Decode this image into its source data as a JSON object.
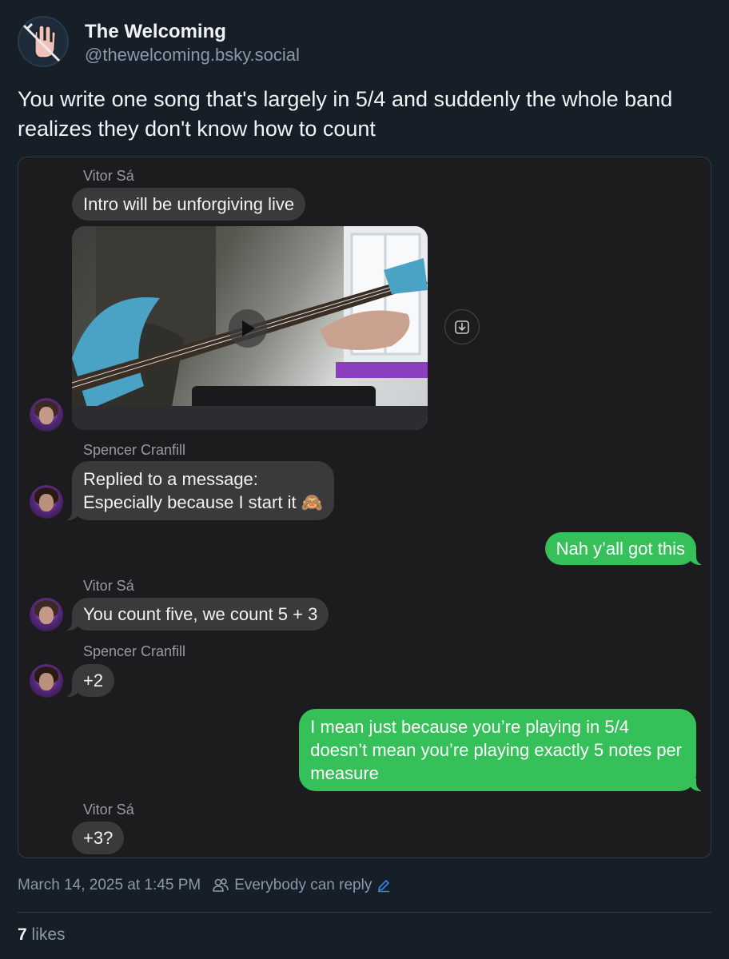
{
  "author": {
    "display_name": "The Welcoming",
    "handle": "@thewelcoming.bsky.social"
  },
  "post": {
    "text": "You write one song that's largely in 5/4 and suddenly the whole band realizes they don't know how to count",
    "timestamp": "March 14, 2025 at 1:45 PM",
    "reply_setting": "Everybody can reply",
    "likes_count": "7",
    "likes_label": "likes"
  },
  "chat": {
    "messages": [
      {
        "sender": "Vitor Sá",
        "text": "Intro will be unforgiving live"
      },
      {
        "sender": "Spencer Cranfill",
        "line1": "Replied to a message:",
        "line2": "Especially because I start it 🙈"
      },
      {
        "text": "Nah y’all got this"
      },
      {
        "sender": "Vitor Sá",
        "text": "You count five, we count 5 + 3"
      },
      {
        "sender": "Spencer Cranfill",
        "text": "+2"
      },
      {
        "line1": "I mean just because you’re playing in 5/4",
        "line2": "doesn’t mean you’re playing exactly 5 notes per",
        "line3": "measure"
      },
      {
        "sender": "Vitor Sá",
        "text": "+3?"
      }
    ]
  },
  "colors": {
    "background": "#161e27",
    "incoming_bubble": "#3a3a3c",
    "outgoing_bubble": "#36c05a",
    "link_accent": "#3b82f6"
  },
  "icons": {
    "profile_avatar": "hand-knife-logo",
    "play": "play-icon",
    "save": "save-download-icon",
    "reply_setting": "people-icon",
    "edit": "pencil-icon"
  }
}
